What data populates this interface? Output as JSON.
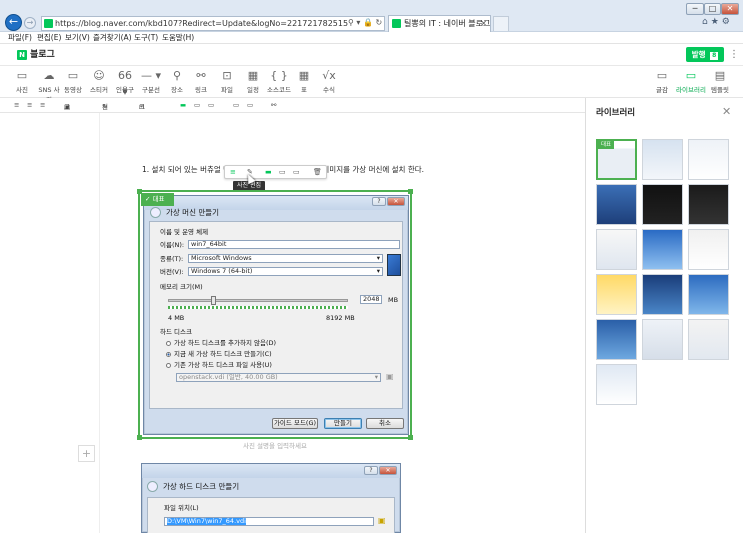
{
  "browser": {
    "url": "https://blog.naver.com/kbd107?Redirect=Update&logNo=221721782515",
    "tab_title": "틸뽕의 IT : 네이버 블로그",
    "window_controls": [
      "─",
      "□",
      "✕"
    ],
    "menu": [
      "파일(F)",
      "편집(E)",
      "보기(V)",
      "즐겨찾기(A)",
      "도구(T)",
      "도움말(H)"
    ]
  },
  "blog": {
    "logo": "N",
    "title": "블로그",
    "publish_label": "발행",
    "publish_count": "8"
  },
  "toolbar": {
    "items": [
      "사진",
      "SNS 사진",
      "동영상",
      "스티커",
      "인용구",
      "구분선",
      "장소",
      "링크",
      "파일",
      "일정",
      "소스코드",
      "표",
      "수식"
    ],
    "right_items": [
      "글감",
      "라이브러리",
      "템플릿"
    ]
  },
  "format_bar": {
    "items": [
      "교체",
      "편집",
      "크기"
    ]
  },
  "editor": {
    "body_text": "1. 설치 되어 있는 버츄얼 박스에서 새로 만들기를 눌러 아이미지를 가상 머신에 설치 한다.",
    "image_toolbar_tooltip": "사진 편집",
    "representative_badge": "대표",
    "caption_placeholder": "사진 설명을 입력하세요",
    "add_button": "+"
  },
  "vm_dialog": {
    "title": "가상 머신 만들기",
    "section_name": "이름 및 운영 체제",
    "name_label": "이름(N):",
    "name_value": "win7_64bit",
    "type_label": "종류(T):",
    "type_value": "Microsoft Windows",
    "version_label": "버전(V):",
    "version_value": "Windows 7 (64-bit)",
    "memory_label": "메모리 크기(M)",
    "memory_value": "2048",
    "memory_unit": "MB",
    "memory_min": "4 MB",
    "memory_max": "8192 MB",
    "memory_fraction": 0.25,
    "disk_section": "하드 디스크",
    "disk_option_1": "가상 하드 디스크를 추가하지 않음(D)",
    "disk_option_2": "지금 새 가상 하드 디스크 만들기(C)",
    "disk_option_3": "기존 가상 하드 디스크 파일 사용(U)",
    "disk_existing": "openstack.vdi (일반, 40.00 GB)",
    "guide_button": "가이드 모드(G)",
    "create_button": "만들기",
    "cancel_button": "취소"
  },
  "hd_dialog": {
    "title": "가상 하드 디스크 만들기",
    "file_location_label": "파일 위치(L)",
    "file_location_value": "D:\\VM\\Win7\\win7_64.vdi"
  },
  "library": {
    "title": "라이브러리",
    "badge": "대표"
  },
  "colors": {
    "naver_green": "#03c75a",
    "select_green": "#4cb050",
    "dialog_blue": "#cfdced"
  }
}
